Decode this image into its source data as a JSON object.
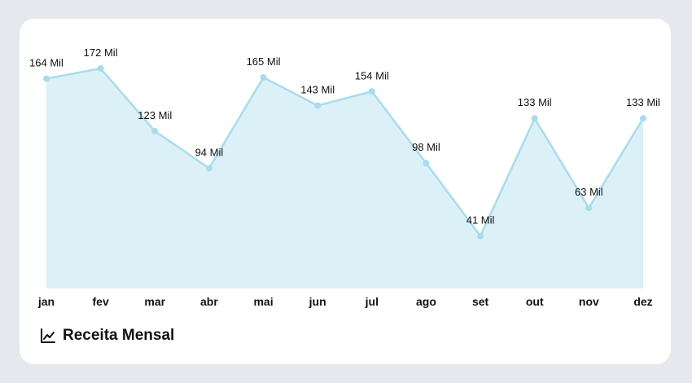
{
  "card": {
    "title": "Receita Mensal",
    "icon": "line-chart-icon"
  },
  "colors": {
    "background": "#e5e8ec",
    "card": "#ffffff",
    "line": "#a9dcea",
    "area": "#dcf0f8",
    "marker": "#a9dcea",
    "text": "#111111"
  },
  "chart_data": {
    "type": "area",
    "title": "Receita Mensal",
    "categories": [
      "jan",
      "fev",
      "mar",
      "abr",
      "mai",
      "jun",
      "jul",
      "ago",
      "set",
      "out",
      "nov",
      "dez"
    ],
    "series": [
      {
        "values": [
          164000,
          172000,
          123000,
          94000,
          165000,
          143000,
          154000,
          98000,
          41000,
          133000,
          63000,
          133000
        ],
        "labels": [
          "164 Mil",
          "172 Mil",
          "123 Mil",
          "94 Mil",
          "165 Mil",
          "143 Mil",
          "154 Mil",
          "98 Mil",
          "41 Mil",
          "133 Mil",
          "63 Mil",
          "133 Mil"
        ]
      }
    ],
    "ylim": [
      0,
      172000
    ],
    "grid": false,
    "legend": "none",
    "xlabel": "",
    "ylabel": ""
  }
}
